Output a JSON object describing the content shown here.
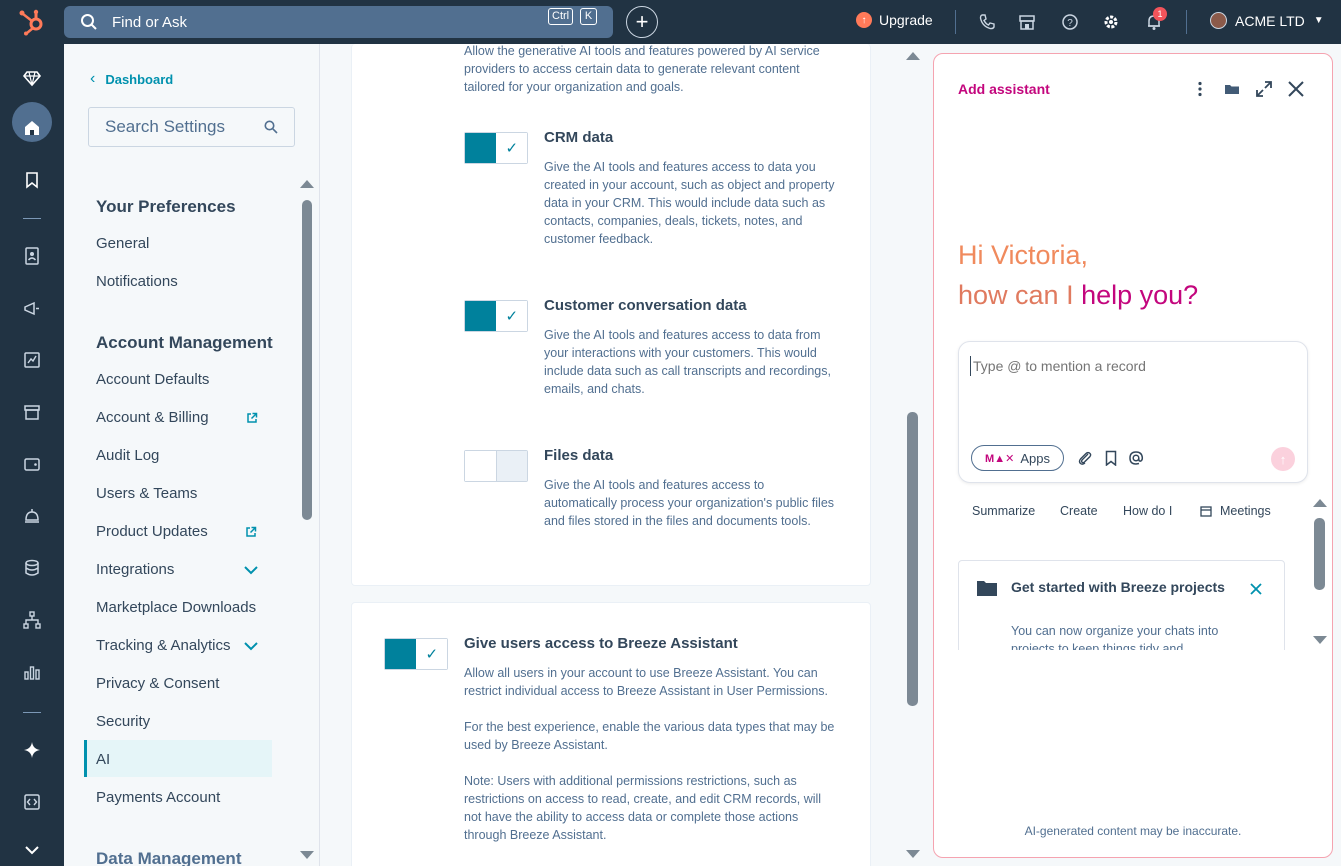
{
  "topbar": {
    "search_placeholder": "Find or Ask",
    "kbd_ctrl": "Ctrl",
    "kbd_k": "K",
    "add_label": "+",
    "upgrade_label": "Upgrade",
    "notification_count": "1",
    "account_name": "ACME LTD"
  },
  "settings": {
    "back_label": "Dashboard",
    "search_placeholder": "Search Settings",
    "sections": [
      {
        "title": "Your Preferences",
        "items": [
          "General",
          "Notifications"
        ]
      },
      {
        "title": "Account Management",
        "items": [
          "Account Defaults",
          "Account & Billing",
          "Audit Log",
          "Users & Teams",
          "Product Updates",
          "Integrations",
          "Marketplace Downloads",
          "Tracking & Analytics",
          "Privacy & Consent",
          "Security",
          "AI",
          "Payments Account"
        ]
      },
      {
        "title": "Data Management",
        "items": []
      }
    ],
    "active_item": "AI"
  },
  "main": {
    "intro_text": "Allow the generative AI tools and features powered by AI service providers to access certain data to generate relevant content tailored for your organization and goals.",
    "options": [
      {
        "title": "CRM data",
        "enabled": true,
        "desc": "Give the AI tools and features access to data you created in your account, such as object and property data in your CRM. This would include data such as contacts, companies, deals, tickets, notes, and customer feedback."
      },
      {
        "title": "Customer conversation data",
        "enabled": true,
        "desc": "Give the AI tools and features access to data from your interactions with your customers. This would include data such as call transcripts and recordings, emails, and chats."
      },
      {
        "title": "Files data",
        "enabled": false,
        "desc": "Give the AI tools and features access to automatically process your organization's public files and files stored in the files and documents tools."
      }
    ],
    "assistant_access": {
      "title": "Give users access to Breeze Assistant",
      "enabled": true,
      "desc1": "Allow all users in your account to use Breeze Assistant. You can restrict individual access to Breeze Assistant in User Permissions.",
      "desc2": "For the best experience, enable the various data types that may be used by Breeze Assistant.",
      "desc3": "Note: Users with additional permissions restrictions, such as restrictions on access to read, create, and edit CRM records, will not have the ability to access data or complete those actions through Breeze Assistant."
    }
  },
  "assistant": {
    "title": "Add assistant",
    "greeting_line1": "Hi Victoria,",
    "greeting_line2_a": "how can I ",
    "greeting_line2_b": "help you?",
    "input_placeholder": "Type @ to mention a record",
    "apps_label": "Apps",
    "apps_glyphs": "M▲✕",
    "chips": [
      "Summarize",
      "Create",
      "How do I",
      "Meetings"
    ],
    "tip_title": "Get started with Breeze projects",
    "tip_desc": "You can now organize your chats into projects to keep things tidy and",
    "disclaimer": "AI-generated content may be inaccurate."
  },
  "colors": {
    "topbar_bg": "#213343",
    "accent_teal": "#00819c",
    "assistant_magenta": "#c3067d",
    "greeting_orange": "#f08a5d"
  }
}
